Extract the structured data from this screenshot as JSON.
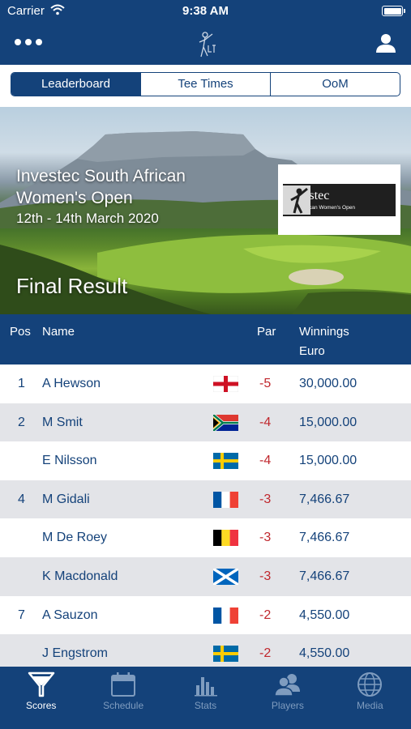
{
  "status_bar": {
    "carrier": "Carrier",
    "time": "9:38 AM"
  },
  "segments": [
    {
      "label": "Leaderboard",
      "active": true
    },
    {
      "label": "Tee Times",
      "active": false
    },
    {
      "label": "OoM",
      "active": false
    }
  ],
  "event": {
    "title": "Investec South African Women's Open",
    "dates": "12th - 14th March 2020",
    "result_label": "Final Result",
    "sponsor": {
      "brand": "Investec",
      "subtitle": "South African Women's Open"
    }
  },
  "table": {
    "headers": {
      "pos": "Pos",
      "name": "Name",
      "par": "Par",
      "winnings": "Winnings",
      "currency": "Euro"
    },
    "rows": [
      {
        "pos": "1",
        "name": "A Hewson",
        "flag": "england-flag",
        "par": "-5",
        "winnings": "30,000.00"
      },
      {
        "pos": "2",
        "name": "M Smit",
        "flag": "south-africa-flag",
        "par": "-4",
        "winnings": "15,000.00"
      },
      {
        "pos": "",
        "name": "E Nilsson",
        "flag": "sweden-flag",
        "par": "-4",
        "winnings": "15,000.00"
      },
      {
        "pos": "4",
        "name": "M Gidali",
        "flag": "france-flag",
        "par": "-3",
        "winnings": "7,466.67"
      },
      {
        "pos": "",
        "name": "M De Roey",
        "flag": "belgium-flag",
        "par": "-3",
        "winnings": "7,466.67"
      },
      {
        "pos": "",
        "name": "K Macdonald",
        "flag": "scotland-flag",
        "par": "-3",
        "winnings": "7,466.67"
      },
      {
        "pos": "7",
        "name": "A Sauzon",
        "flag": "france-flag",
        "par": "-2",
        "winnings": "4,550.00"
      },
      {
        "pos": "",
        "name": "J Engstrom",
        "flag": "sweden-flag",
        "par": "-2",
        "winnings": "4,550.00"
      }
    ]
  },
  "tabs": [
    {
      "label": "Scores",
      "icon": "funnel-icon",
      "active": true
    },
    {
      "label": "Schedule",
      "icon": "calendar-icon",
      "active": false
    },
    {
      "label": "Stats",
      "icon": "bar-chart-icon",
      "active": false
    },
    {
      "label": "Players",
      "icon": "players-icon",
      "active": false
    },
    {
      "label": "Media",
      "icon": "globe-icon",
      "active": false
    }
  ],
  "colors": {
    "brand": "#14427a",
    "par": "#c0272d",
    "row_alt": "#e3e4e8"
  }
}
